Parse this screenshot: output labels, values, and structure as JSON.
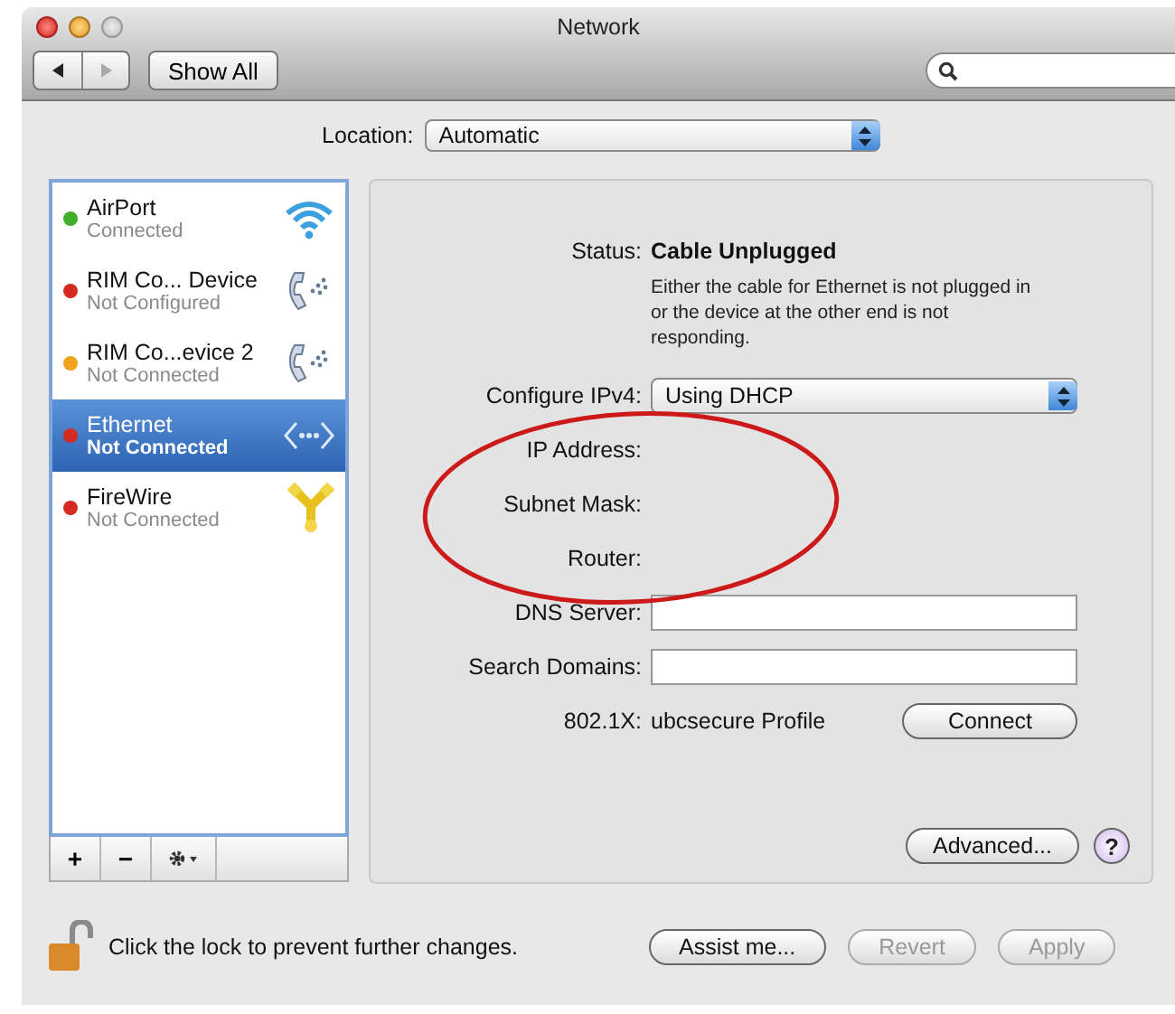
{
  "window": {
    "title": "Network"
  },
  "toolbar": {
    "back_disabled": false,
    "forward_disabled": true,
    "show_all": "Show All"
  },
  "location": {
    "label": "Location:",
    "value": "Automatic"
  },
  "services": [
    {
      "name": "AirPort",
      "status": "Connected",
      "color": "#3fae2a",
      "kind": "wifi",
      "selected": false
    },
    {
      "name": "RIM Co... Device",
      "status": "Not Configured",
      "color": "#d42a20",
      "kind": "phone",
      "selected": false
    },
    {
      "name": "RIM Co...evice 2",
      "status": "Not Connected",
      "color": "#f0a21a",
      "kind": "phone",
      "selected": false
    },
    {
      "name": "Ethernet",
      "status": "Not Connected",
      "color": "#d42a20",
      "kind": "ethernet",
      "selected": true
    },
    {
      "name": "FireWire",
      "status": "Not Connected",
      "color": "#d42a20",
      "kind": "firewire",
      "selected": false
    }
  ],
  "list_toolbar": {
    "add": "+",
    "remove": "−"
  },
  "detail": {
    "status_label": "Status:",
    "status_value": "Cable Unplugged",
    "status_description": "Either the cable for Ethernet is not plugged in or the device at the other end is not responding.",
    "configure_label": "Configure IPv4:",
    "configure_value": "Using DHCP",
    "fields": [
      {
        "label": "IP Address:",
        "kind": "info"
      },
      {
        "label": "Subnet Mask:",
        "kind": "info"
      },
      {
        "label": "Router:",
        "kind": "info"
      },
      {
        "label": "DNS Server:",
        "kind": "input"
      },
      {
        "label": "Search Domains:",
        "kind": "input"
      }
    ],
    "auth_label": "802.1X:",
    "auth_value": "ubcsecure Profile",
    "connect_button": "Connect",
    "advanced_button": "Advanced...",
    "help_button": "?"
  },
  "lock_text": "Click the lock to prevent further changes.",
  "buttons": [
    {
      "label": "Assist me...",
      "disabled": false
    },
    {
      "label": "Revert",
      "disabled": true
    },
    {
      "label": "Apply",
      "disabled": true
    }
  ]
}
